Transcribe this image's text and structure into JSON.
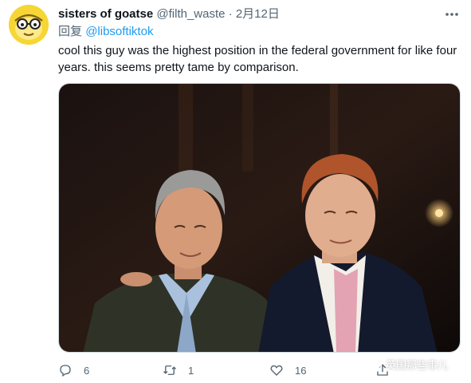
{
  "tweet": {
    "display_name": "sisters of goatse",
    "handle": "@filth_waste",
    "separator": "·",
    "date": "2月12日",
    "reply_prefix": "回复",
    "reply_to": "@libsoftiktok",
    "text": "cool this guy was the highest position in the federal government for like four years. this seems pretty tame by comparison."
  },
  "actions": {
    "reply_count": "6",
    "retweet_count": "1",
    "like_count": "16"
  },
  "watermark": {
    "text": "英国那些事儿"
  },
  "icons": {
    "more": "more-dots-icon",
    "reply": "reply-bubble-icon",
    "retweet": "retweet-icon",
    "like": "heart-icon",
    "share": "share-icon",
    "watermark": "wechat-icon"
  },
  "colors": {
    "link": "#1d9bf0",
    "secondary_text": "#536471",
    "avatar_bg": "#f5d634"
  }
}
